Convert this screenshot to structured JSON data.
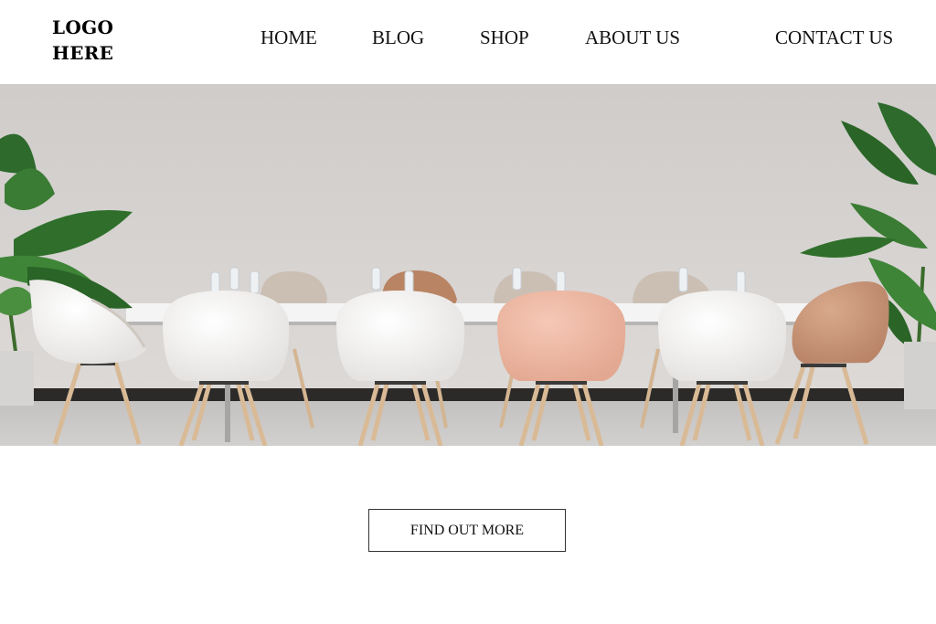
{
  "logo": {
    "line1": "LOGO",
    "line2": "HERE"
  },
  "nav": {
    "home": "HOME",
    "blog": "BLOG",
    "shop": "SHOP",
    "about": "ABOUT US",
    "contact": "CONTACT US"
  },
  "hero": {
    "image_subject": "conference room with white meeting table, white and peach shell chairs with wooden legs, and potted banana-leaf plants",
    "colors": {
      "wall": "#d6d3d1",
      "floor": "#c9c7c5",
      "table": "#f3f3f3",
      "white_chair": "#f4f3f2",
      "peach_chair": "#ecb7a3",
      "tan_chair": "#c89a80",
      "plant": "#2f6a2a"
    }
  },
  "cta": {
    "label": "FIND OUT MORE"
  }
}
